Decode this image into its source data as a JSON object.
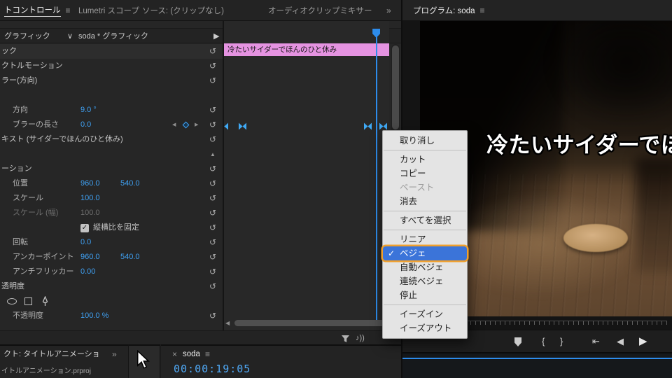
{
  "colors": {
    "accent_blue": "#2d8ceb",
    "value_blue": "#3fa0f2",
    "clip_pink": "#e593e1",
    "menu_highlight_bg": "#3b74d9",
    "tutorial_outline_orange": "#f0a02c",
    "timecode_blue": "#4fa8f5"
  },
  "left_tabs": {
    "overflow": "»",
    "tabs": [
      {
        "label": "トコントロール",
        "active": true,
        "menu_icon": "≡"
      },
      {
        "label": "Lumetri スコープ"
      },
      {
        "label": "ソース: (クリップなし)"
      },
      {
        "label": "オーディオクリップミキサー"
      }
    ]
  },
  "effect_panel": {
    "header": {
      "track": "グラフィック",
      "chevron": "∨",
      "clip": "soda * グラフィック",
      "expand_arrow": "▶"
    },
    "rows": [
      {
        "type": "section",
        "label": "ック"
      },
      {
        "type": "section",
        "label": "クトルモーション"
      },
      {
        "type": "section",
        "label": "ラー(方向)"
      },
      {
        "type": "spacer"
      },
      {
        "type": "param",
        "label": "方向",
        "values": [
          "9.0 °"
        ]
      },
      {
        "type": "param",
        "label": "ブラーの長さ",
        "values": [
          "0.0"
        ],
        "keyframe_nav": true
      },
      {
        "type": "section",
        "label": "キスト (サイダーでほんのひと休み)"
      },
      {
        "type": "divider"
      },
      {
        "type": "section",
        "label": "ーション"
      },
      {
        "type": "param",
        "label": "位置",
        "values": [
          "960.0",
          "540.0"
        ]
      },
      {
        "type": "param",
        "label": "スケール",
        "values": [
          "100.0"
        ]
      },
      {
        "type": "param",
        "label": "スケール (幅)",
        "values": [
          "100.0"
        ],
        "disabled": true
      },
      {
        "type": "checkbox",
        "label": "縦横比を固定",
        "checked": true
      },
      {
        "type": "param",
        "label": "回転",
        "values": [
          "0.0"
        ]
      },
      {
        "type": "param",
        "label": "アンカーポイント",
        "values": [
          "960.0",
          "540.0"
        ]
      },
      {
        "type": "param",
        "label": "アンチフリッカー",
        "values": [
          "0.00"
        ]
      },
      {
        "type": "section",
        "label": "透明度"
      },
      {
        "type": "masktools"
      },
      {
        "type": "param",
        "label": "不透明度",
        "values": [
          "100.0 %"
        ]
      }
    ],
    "clip_title": "冷たいサイダーでほんのひと休み",
    "keyframes_pct": [
      0,
      11,
      87,
      96
    ],
    "playhead_pct": 92
  },
  "context_menu": {
    "items": [
      {
        "label": "取り消し"
      },
      {
        "sep": true
      },
      {
        "label": "カット"
      },
      {
        "label": "コピー"
      },
      {
        "label": "ペースト",
        "disabled": true
      },
      {
        "label": "消去"
      },
      {
        "sep": true
      },
      {
        "label": "すべてを選択"
      },
      {
        "sep": true
      },
      {
        "label": "リニア"
      },
      {
        "label": "ベジェ",
        "checked": true,
        "selected": true,
        "highlighted": true
      },
      {
        "label": "自動ベジェ"
      },
      {
        "label": "連続ベジェ"
      },
      {
        "label": "停止"
      },
      {
        "sep": true
      },
      {
        "label": "イーズイン"
      },
      {
        "label": "イーズアウト"
      }
    ]
  },
  "program": {
    "title": "プログラム: soda",
    "menu_icon": "≡",
    "overlay_text": "冷たいサイダーでほんのひと休み",
    "transport": [
      {
        "name": "add-marker-button",
        "glyph": "marker"
      },
      {
        "name": "mark-in-button",
        "glyph": "{"
      },
      {
        "name": "mark-out-button",
        "glyph": "}"
      },
      {
        "name": "go-to-in-button",
        "glyph": "⇤"
      },
      {
        "name": "step-back-button",
        "glyph": "◀"
      },
      {
        "name": "play-button",
        "glyph": "▶"
      }
    ]
  },
  "project_panel": {
    "title": "クト: タイトルアニメーショ",
    "overflow": "»",
    "filename": "イトルアニメーション.prproj"
  },
  "sequence_tab": {
    "close": "×",
    "label": "soda",
    "menu_icon": "≡",
    "timecode": "00:00:19:05"
  }
}
